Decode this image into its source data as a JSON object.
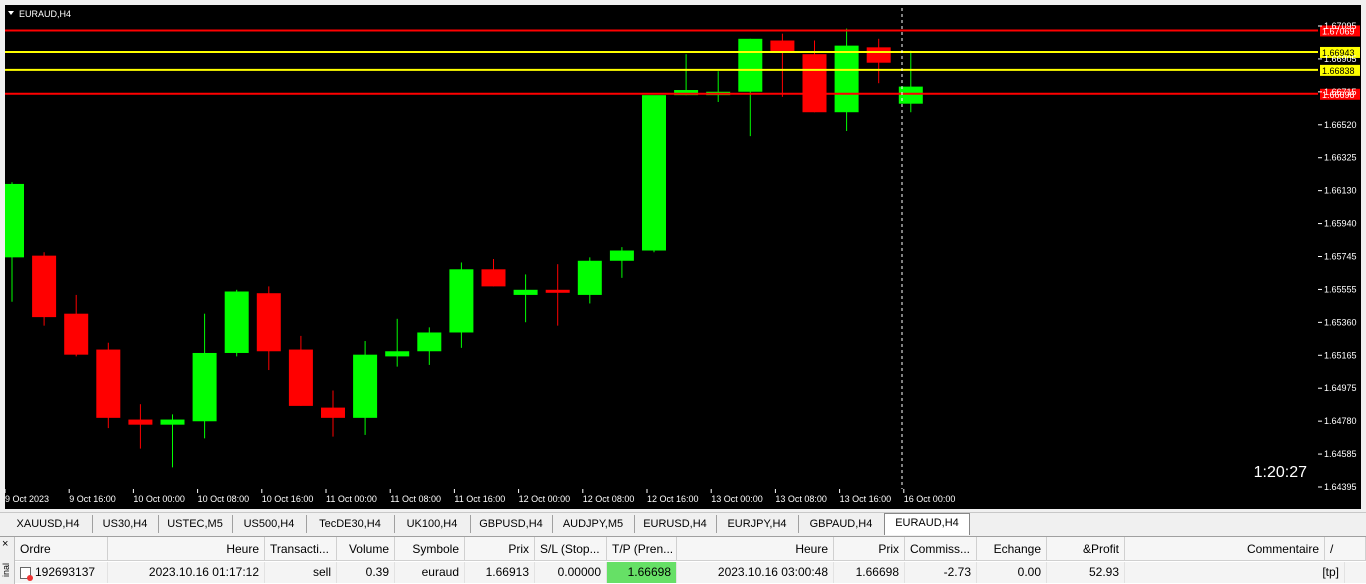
{
  "chart": {
    "symbol_label": "EURAUD,H4",
    "countdown": "1:20:27",
    "colors": {
      "bg": "#000000",
      "bull": "#00ff00",
      "bear": "#ff0000",
      "line_red": "#ff0000",
      "line_yellow": "#ffff00",
      "vline": "#ffffff"
    },
    "price_ticks": [
      "1.67095",
      "1.66905",
      "1.66715",
      "1.66520",
      "1.66325",
      "1.66130",
      "1.65940",
      "1.65745",
      "1.65555",
      "1.65360",
      "1.65165",
      "1.64975",
      "1.64780",
      "1.64585",
      "1.64395"
    ],
    "time_labels": [
      "9 Oct 2023",
      "9 Oct 16:00",
      "10 Oct 00:00",
      "10 Oct 08:00",
      "10 Oct 16:00",
      "11 Oct 00:00",
      "11 Oct 08:00",
      "11 Oct 16:00",
      "12 Oct 00:00",
      "12 Oct 08:00",
      "12 Oct 16:00",
      "13 Oct 00:00",
      "13 Oct 08:00",
      "13 Oct 16:00",
      "16 Oct 00:00"
    ],
    "levels": [
      {
        "price": 1.67069,
        "label": "1.67069",
        "kind": "red"
      },
      {
        "price": 1.66943,
        "label": "1.66943",
        "kind": "yellow"
      },
      {
        "price": 1.66838,
        "label": "1.66838",
        "kind": "yellow"
      },
      {
        "price": 1.66698,
        "label": "1.66698",
        "kind": "red"
      }
    ],
    "candles": [
      {
        "o": 1.6574,
        "h": 1.6618,
        "l": 1.6548,
        "c": 1.6617
      },
      {
        "o": 1.6575,
        "h": 1.6577,
        "l": 1.6534,
        "c": 1.6539
      },
      {
        "o": 1.6541,
        "h": 1.6552,
        "l": 1.6516,
        "c": 1.6517
      },
      {
        "o": 1.652,
        "h": 1.6524,
        "l": 1.6474,
        "c": 1.648
      },
      {
        "o": 1.6479,
        "h": 1.6488,
        "l": 1.6462,
        "c": 1.6476
      },
      {
        "o": 1.6476,
        "h": 1.6482,
        "l": 1.6451,
        "c": 1.6479
      },
      {
        "o": 1.6478,
        "h": 1.6541,
        "l": 1.6468,
        "c": 1.6518
      },
      {
        "o": 1.6518,
        "h": 1.6555,
        "l": 1.6516,
        "c": 1.6554
      },
      {
        "o": 1.6553,
        "h": 1.6557,
        "l": 1.6508,
        "c": 1.6519
      },
      {
        "o": 1.652,
        "h": 1.6528,
        "l": 1.6487,
        "c": 1.6487
      },
      {
        "o": 1.6486,
        "h": 1.6496,
        "l": 1.6469,
        "c": 1.648
      },
      {
        "o": 1.648,
        "h": 1.6525,
        "l": 1.647,
        "c": 1.6517
      },
      {
        "o": 1.6516,
        "h": 1.6538,
        "l": 1.651,
        "c": 1.6519
      },
      {
        "o": 1.6519,
        "h": 1.6533,
        "l": 1.6511,
        "c": 1.653
      },
      {
        "o": 1.653,
        "h": 1.6571,
        "l": 1.6521,
        "c": 1.6567
      },
      {
        "o": 1.6567,
        "h": 1.6573,
        "l": 1.6557,
        "c": 1.6557
      },
      {
        "o": 1.6552,
        "h": 1.6564,
        "l": 1.6536,
        "c": 1.6555
      },
      {
        "o": 1.6555,
        "h": 1.657,
        "l": 1.6534,
        "c": 1.6554
      },
      {
        "o": 1.6552,
        "h": 1.6574,
        "l": 1.6547,
        "c": 1.6572
      },
      {
        "o": 1.6572,
        "h": 1.658,
        "l": 1.6562,
        "c": 1.6578
      },
      {
        "o": 1.6578,
        "h": 1.6612,
        "l": 1.6577,
        "c": 1.6669
      },
      {
        "o": 1.6669,
        "h": 1.6693,
        "l": 1.6669,
        "c": 1.6672
      },
      {
        "o": 1.6669,
        "h": 1.6683,
        "l": 1.6665,
        "c": 1.6671
      },
      {
        "o": 1.6671,
        "h": 1.6702,
        "l": 1.6645,
        "c": 1.6702
      },
      {
        "o": 1.6701,
        "h": 1.6705,
        "l": 1.6668,
        "c": 1.6694
      },
      {
        "o": 1.6693,
        "h": 1.6701,
        "l": 1.6659,
        "c": 1.6659
      },
      {
        "o": 1.6659,
        "h": 1.6708,
        "l": 1.6648,
        "c": 1.6698
      },
      {
        "o": 1.6697,
        "h": 1.6702,
        "l": 1.6676,
        "c": 1.6688
      },
      {
        "o": 1.6664,
        "h": 1.6695,
        "l": 1.6659,
        "c": 1.6674
      }
    ]
  },
  "tabs": [
    {
      "label": "XAUUSD,H4",
      "active": false
    },
    {
      "label": "US30,H4",
      "active": false
    },
    {
      "label": "USTEC,M5",
      "active": false
    },
    {
      "label": "US500,H4",
      "active": false
    },
    {
      "label": "TecDE30,H4",
      "active": false
    },
    {
      "label": "UK100,H4",
      "active": false
    },
    {
      "label": "GBPUSD,H4",
      "active": false
    },
    {
      "label": "AUDJPY,M5",
      "active": false
    },
    {
      "label": "EURUSD,H4",
      "active": false
    },
    {
      "label": "EURJPY,H4",
      "active": false
    },
    {
      "label": "GBPAUD,H4",
      "active": false
    },
    {
      "label": "EURAUD,H4",
      "active": true
    }
  ],
  "terminal": {
    "close_label": "×",
    "side_label": "inal",
    "headers": {
      "ordre": "Ordre",
      "heure": "Heure",
      "transaction": "Transacti...",
      "volume": "Volume",
      "symbole": "Symbole",
      "prix": "Prix",
      "sl": "S/L (Stop...",
      "tp": "T/P (Pren...",
      "heure2": "Heure",
      "prix2": "Prix",
      "commission": "Commiss...",
      "echange": "Echange",
      "profit": "&Profit",
      "commentaire": "Commentaire",
      "sort": "/"
    },
    "row": {
      "ordre": "192693137",
      "heure": "2023.10.16 01:17:12",
      "transaction": "sell",
      "volume": "0.39",
      "symbole": "euraud",
      "prix": "1.66913",
      "sl": "0.00000",
      "tp": "1.66698",
      "heure2": "2023.10.16 03:00:48",
      "prix2": "1.66698",
      "commission": "-2.73",
      "echange": "0.00",
      "profit": "52.93",
      "commentaire": "[tp]"
    },
    "tp_highlight": "#66e066"
  }
}
